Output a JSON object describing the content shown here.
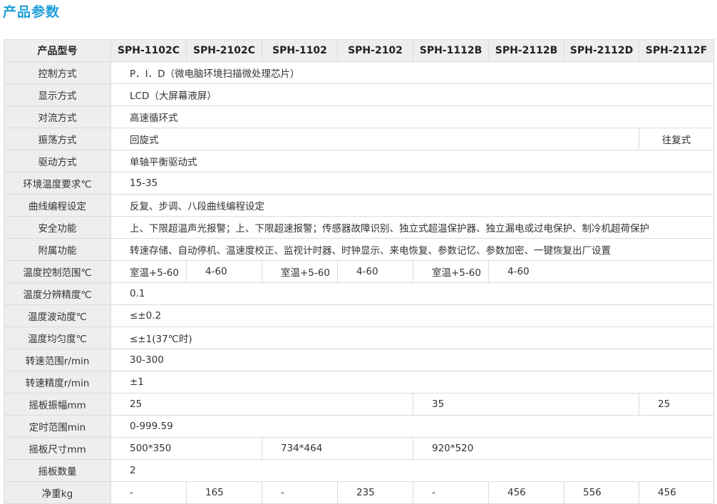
{
  "title": "产品参数",
  "header": {
    "label": "产品型号",
    "models": [
      "SPH-1102C",
      "SPH-2102C",
      "SPH-1102",
      "SPH-2102",
      "SPH-1112B",
      "SPH-2112B",
      "SPH-2112D",
      "SPH-2112F"
    ]
  },
  "rows": {
    "control": {
      "label": "控制方式",
      "value": "P．I．D（微电脑环境扫描微处理芯片）"
    },
    "display": {
      "label": "显示方式",
      "value": "LCD（大屏幕液屏）"
    },
    "convection": {
      "label": "对流方式",
      "value": "高速循环式"
    },
    "oscillation": {
      "label": "振荡方式",
      "value_main": "回旋式",
      "value_last": "往复式"
    },
    "drive": {
      "label": "驱动方式",
      "value": "单轴平衡驱动式"
    },
    "env_temp": {
      "label": "环境温度要求℃",
      "value": "15-35"
    },
    "curve": {
      "label": "曲线编程设定",
      "value": "反复、步调、八段曲线编程设定"
    },
    "safety": {
      "label": "安全功能",
      "value": "上、下限超温声光报警；上、下限超速报警；传感器故障识别、独立式超温保护器、独立漏电或过电保护、制冷机超荷保护"
    },
    "accessory": {
      "label": "附属功能",
      "value": "转速存储、自动停机、温速度校正、监视计时器、时钟显示、来电恢复、参数记忆、参数加密、一键恢复出厂设置"
    },
    "temp_range": {
      "label": "温度控制范围℃",
      "values": [
        "室温+5-60",
        "4-60",
        "室温+5-60",
        "4-60",
        "室温+5-60",
        "4-60"
      ]
    },
    "temp_res": {
      "label": "温度分辨精度℃",
      "value": "0.1"
    },
    "temp_fluct": {
      "label": "温度波动度℃",
      "value": "≤±0.2"
    },
    "temp_unif": {
      "label": "温度均匀度℃",
      "value": "≤±1(37℃时)"
    },
    "speed_range": {
      "label": "转速范围r/min",
      "value": "30-300"
    },
    "speed_acc": {
      "label": "转速精度r/min",
      "value": "±1"
    },
    "amplitude": {
      "label": "摇板振幅mm",
      "values": [
        "25",
        "35",
        "25"
      ]
    },
    "timer": {
      "label": "定时范围min",
      "value": "0-999.59"
    },
    "board_size": {
      "label": "摇板尺寸mm",
      "values": [
        "500*350",
        "734*464",
        "920*520"
      ]
    },
    "board_count": {
      "label": "摇板数量",
      "value": "2"
    },
    "net_weight": {
      "label": "净重kg",
      "values": [
        "-",
        "165",
        "-",
        "235",
        "-",
        "456",
        "556",
        "456"
      ]
    }
  }
}
